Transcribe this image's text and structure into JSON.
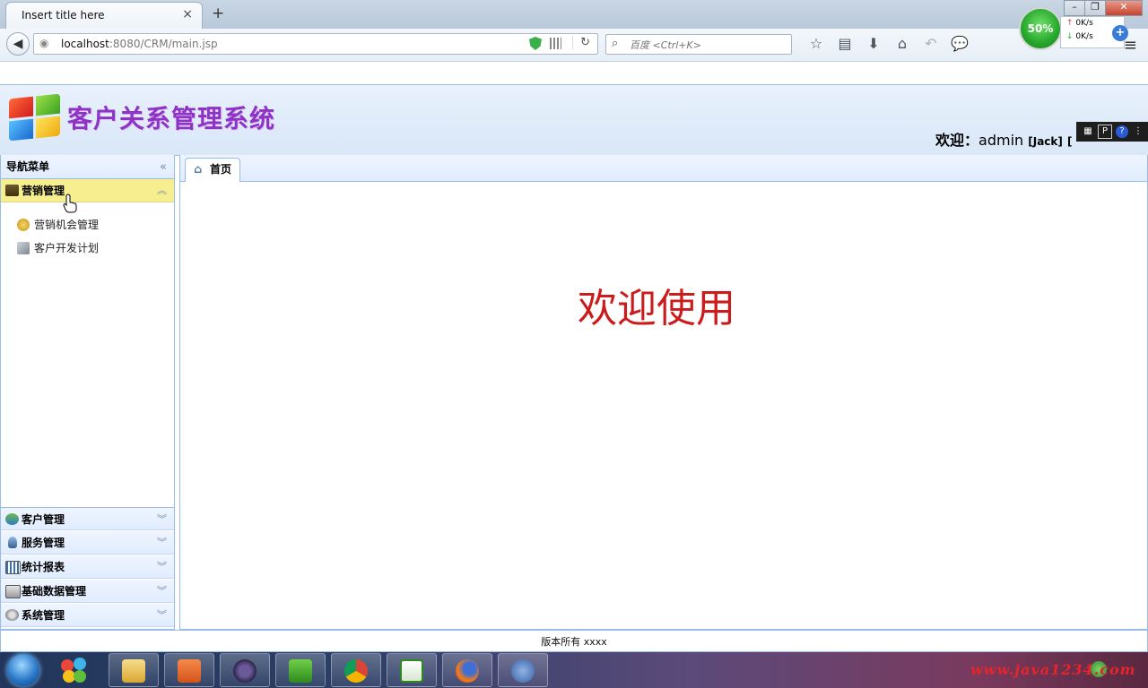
{
  "browser": {
    "tab_title": "Insert title here",
    "tab_close": "×",
    "new_tab": "+",
    "url_host": "localhost",
    "url_rest": ":8080/CRM/main.jsp",
    "search_placeholder": "百度 <Ctrl+K>",
    "speed_percent": "50%",
    "upload_rate": "0K/s",
    "download_rate": "0K/s"
  },
  "header": {
    "app_title": "客户关系管理系统",
    "welcome_label": "欢迎：",
    "username": "admin",
    "display_name": "[Jack]",
    "trailing_bracket": "["
  },
  "nav": {
    "title": "导航菜单",
    "sections": [
      {
        "label": "营销管理",
        "icon": "marketing-icon",
        "expanded": true,
        "items": [
          {
            "label": "营销机会管理",
            "icon": "coins-icon"
          },
          {
            "label": "客户开发计划",
            "icon": "plan-icon"
          }
        ]
      },
      {
        "label": "客户管理",
        "icon": "customers-icon"
      },
      {
        "label": "服务管理",
        "icon": "service-icon"
      },
      {
        "label": "统计报表",
        "icon": "report-icon"
      },
      {
        "label": "基础数据管理",
        "icon": "database-icon"
      },
      {
        "label": "系统管理",
        "icon": "settings-icon"
      }
    ]
  },
  "main": {
    "tabs": [
      {
        "label": "首页",
        "icon": "home-icon"
      }
    ],
    "welcome_text": "欢迎使用"
  },
  "footer": {
    "copyright": "版本所有 xxxx"
  },
  "taskbar": {
    "watermark": "www.java1234.com"
  },
  "colors": {
    "brand_title": "#8e33c6",
    "welcome_red": "#cc1b1b",
    "active_section": "#f6ee8f",
    "panel_border": "#99bbe8"
  }
}
